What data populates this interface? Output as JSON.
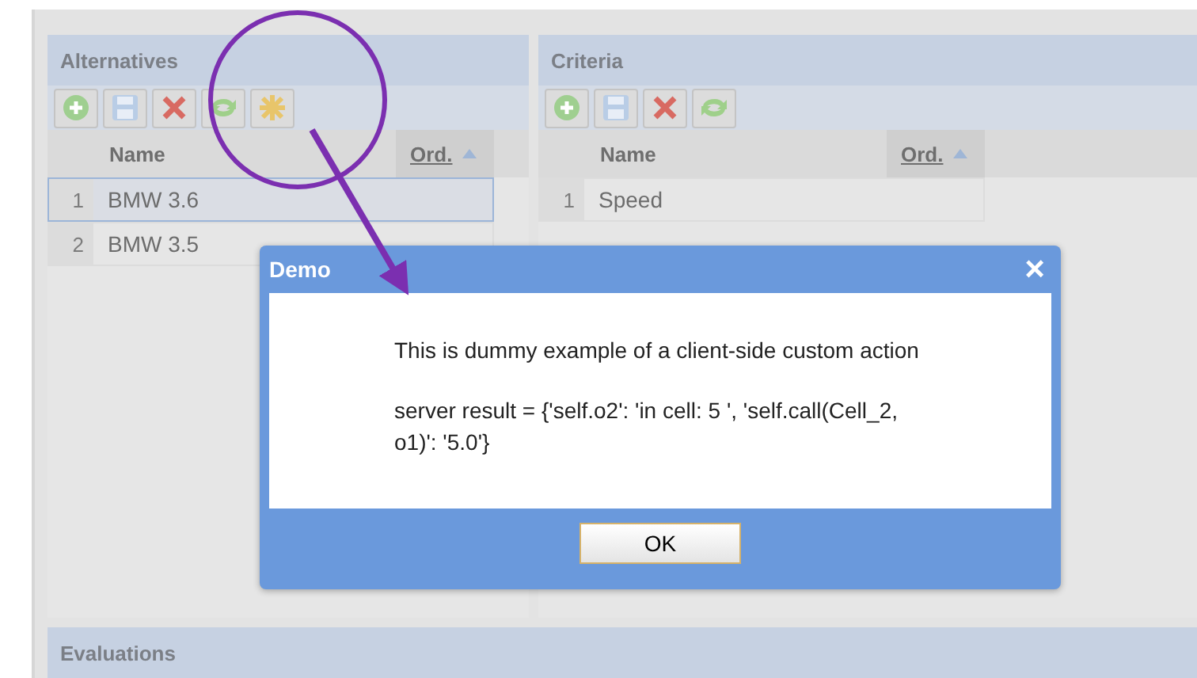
{
  "alternatives": {
    "title": "Alternatives",
    "toolbar": [
      {
        "kind": "add"
      },
      {
        "kind": "save"
      },
      {
        "kind": "delete"
      },
      {
        "kind": "refresh"
      },
      {
        "kind": "custom"
      }
    ],
    "columns": [
      "Name",
      "Ord."
    ],
    "rows": [
      {
        "index": "1",
        "name": "BMW 3.6",
        "selected": true
      },
      {
        "index": "2",
        "name": "BMW 3.5",
        "selected": false
      }
    ]
  },
  "criteria": {
    "title": "Criteria",
    "toolbar": [
      {
        "kind": "add"
      },
      {
        "kind": "save"
      },
      {
        "kind": "delete"
      },
      {
        "kind": "refresh"
      }
    ],
    "columns": [
      "Name",
      "Ord."
    ],
    "rows": [
      {
        "index": "1",
        "name": "Speed",
        "selected": false
      }
    ]
  },
  "evaluations": {
    "title": "Evaluations"
  },
  "dialog": {
    "title": "Demo",
    "close": "×",
    "message": "This is dummy example of a client-side custom action",
    "result": "server result = {'self.o2': 'in cell: 5 ', 'self.call(Cell_2, o1)': '5.0'}",
    "button": "OK"
  }
}
